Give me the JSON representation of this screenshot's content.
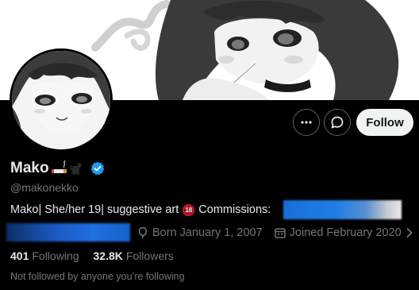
{
  "profile": {
    "display_name": "Mako",
    "name_emojis": [
      "cigarette-emoji",
      "black-cat-emoji"
    ],
    "verified": true,
    "handle": "@makonekko",
    "bio": {
      "part1": "Mako ",
      "part2": " | She/her 19 ",
      "part3": " | suggestive art ",
      "badge": "18",
      "part4": " Commissions:"
    },
    "born": "Born January 1, 2007",
    "joined": "Joined February 2020",
    "following_count": "401",
    "following_label": "Following",
    "followers_count": "32.8K",
    "followers_label": "Followers",
    "not_followed_text": "Not followed by anyone you’re following"
  },
  "actions": {
    "follow_label": "Follow"
  },
  "colors": {
    "background": "#000000",
    "verified_blue": "#1d9bf0",
    "follow_bg": "#eff3f4",
    "muted_text": "#71767b"
  }
}
